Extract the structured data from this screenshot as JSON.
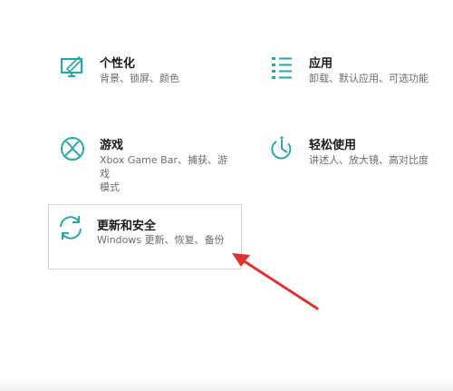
{
  "settings": {
    "tiles": [
      {
        "title": "个性化",
        "desc": "背景、锁屏、颜色",
        "icon": "personalization-icon"
      },
      {
        "title": "应用",
        "desc": "卸载、默认应用、可选功能",
        "icon": "apps-icon"
      },
      {
        "title": "游戏",
        "desc_line1": "Xbox Game Bar、捕获、游戏",
        "desc_line2": "模式",
        "icon": "xbox-icon"
      },
      {
        "title": "轻松使用",
        "desc": "讲述人、放大镜、高对比度",
        "icon": "ease-of-access-icon"
      },
      {
        "title": "更新和安全",
        "desc": "Windows 更新、恢复、备份",
        "icon": "update-security-icon"
      }
    ]
  },
  "colors": {
    "accent": "#2aa6a6",
    "arrow": "#e03131"
  }
}
